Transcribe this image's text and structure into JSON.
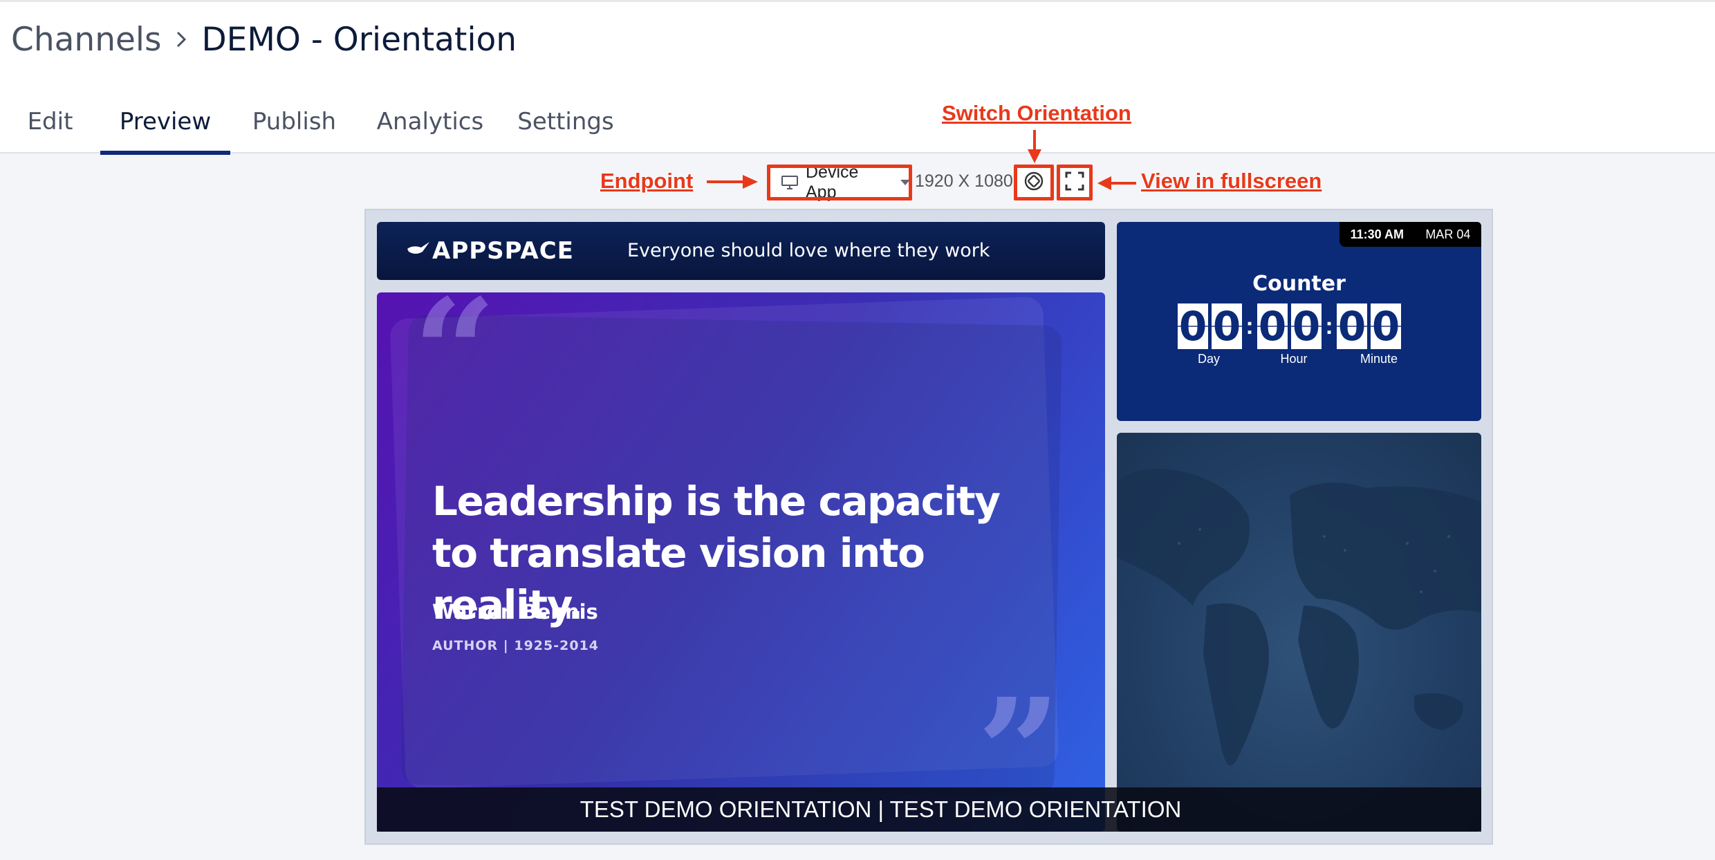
{
  "breadcrumb": {
    "root": "Channels",
    "current": "DEMO - Orientation"
  },
  "tabs": [
    {
      "label": "Edit",
      "active": false
    },
    {
      "label": "Preview",
      "active": true
    },
    {
      "label": "Publish",
      "active": false
    },
    {
      "label": "Analytics",
      "active": false
    },
    {
      "label": "Settings",
      "active": false
    }
  ],
  "toolbar": {
    "endpoint_value": "Device App",
    "resolution": "1920 X 1080",
    "endpoint_icon": "monitor-icon",
    "rotate_icon": "rotate-device-icon",
    "fullscreen_icon": "fullscreen-icon"
  },
  "annotations": {
    "endpoint": "Endpoint",
    "switch_orientation": "Switch Orientation",
    "fullscreen": "View in fullscreen",
    "color": "#e8391b"
  },
  "preview": {
    "banner": {
      "logo": "APPSPACE",
      "tagline": "Everyone should love where they work"
    },
    "quote": {
      "text": "Leadership is the capacity to translate vision into reality.",
      "author": "Warren Bennis",
      "role": "AUTHOR | 1925-2014"
    },
    "clock": {
      "time": "11:30 AM",
      "date": "MAR 04"
    },
    "counter": {
      "title": "Counter",
      "units": [
        {
          "label": "Day",
          "digits": [
            "0",
            "0"
          ]
        },
        {
          "label": "Hour",
          "digits": [
            "0",
            "0"
          ]
        },
        {
          "label": "Minute",
          "digits": [
            "0",
            "0"
          ]
        }
      ]
    },
    "ticker": "TEST DEMO ORIENTATION | TEST DEMO ORIENTATION"
  },
  "colors": {
    "accent": "#0e2a78",
    "annotation": "#e8391b",
    "banner": "#0c2258",
    "counter_bg": "#0b2a78"
  }
}
